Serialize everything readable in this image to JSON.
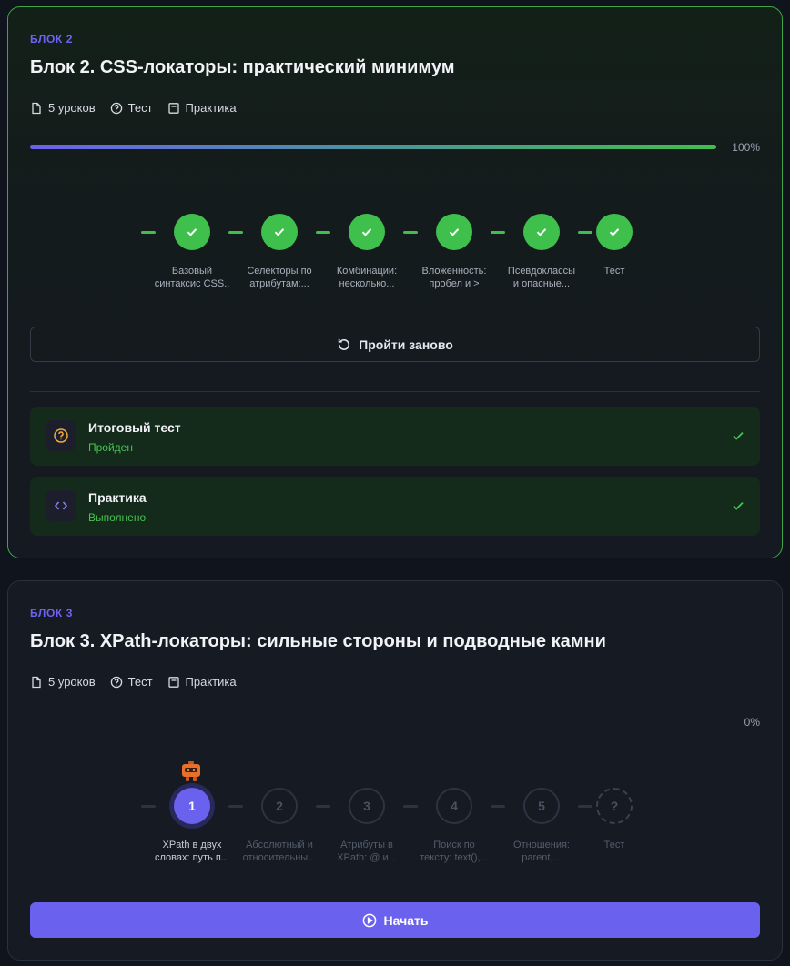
{
  "blocks": [
    {
      "eyebrow": "БЛОК 2",
      "title": "Блок 2. CSS-локаторы: практический минимум",
      "meta": {
        "lessons": "5 уроков",
        "test": "Тест",
        "practice": "Практика"
      },
      "progress_percent": 100,
      "progress_label": "100%",
      "steps": [
        {
          "label_line1": "Базовый",
          "label_line2": "синтаксис CSS..",
          "state": "done"
        },
        {
          "label_line1": "Селекторы по",
          "label_line2": "атрибутам:...",
          "state": "done"
        },
        {
          "label_line1": "Комбинации:",
          "label_line2": "несколько...",
          "state": "done"
        },
        {
          "label_line1": "Вложенность:",
          "label_line2": "пробел и >",
          "state": "done"
        },
        {
          "label_line1": "Псевдоклассы",
          "label_line2": "и опасные...",
          "state": "done"
        },
        {
          "label_line1": "Тест",
          "label_line2": "",
          "state": "done"
        }
      ],
      "action_label": "Пройти заново",
      "items": [
        {
          "title": "Итоговый тест",
          "status": "Пройден",
          "icon": "question-circle-icon"
        },
        {
          "title": "Практика",
          "status": "Выполнено",
          "icon": "code-icon"
        }
      ]
    },
    {
      "eyebrow": "БЛОК 3",
      "title": "Блок 3. XPath-локаторы: сильные стороны и подводные камни",
      "meta": {
        "lessons": "5 уроков",
        "test": "Тест",
        "practice": "Практика"
      },
      "progress_percent": 0,
      "progress_label": "0%",
      "steps": [
        {
          "num": "1",
          "label_line1": "XPath в двух",
          "label_line2": "словах: путь п...",
          "state": "active"
        },
        {
          "num": "2",
          "label_line1": "Абсолютный и",
          "label_line2": "относительны...",
          "state": "todo"
        },
        {
          "num": "3",
          "label_line1": "Атрибуты в",
          "label_line2": "XPath: @ и...",
          "state": "todo"
        },
        {
          "num": "4",
          "label_line1": "Поиск по",
          "label_line2": "тексту: text(),...",
          "state": "todo"
        },
        {
          "num": "5",
          "label_line1": "Отношения:",
          "label_line2": "parent,...",
          "state": "todo"
        },
        {
          "num": "?",
          "label_line1": "Тест",
          "label_line2": "",
          "state": "test"
        }
      ],
      "action_label": "Начать"
    }
  ],
  "colors": {
    "accent": "#6b61ef",
    "success": "#3fbf4c",
    "background": "#10141c",
    "card": "#151a23"
  }
}
